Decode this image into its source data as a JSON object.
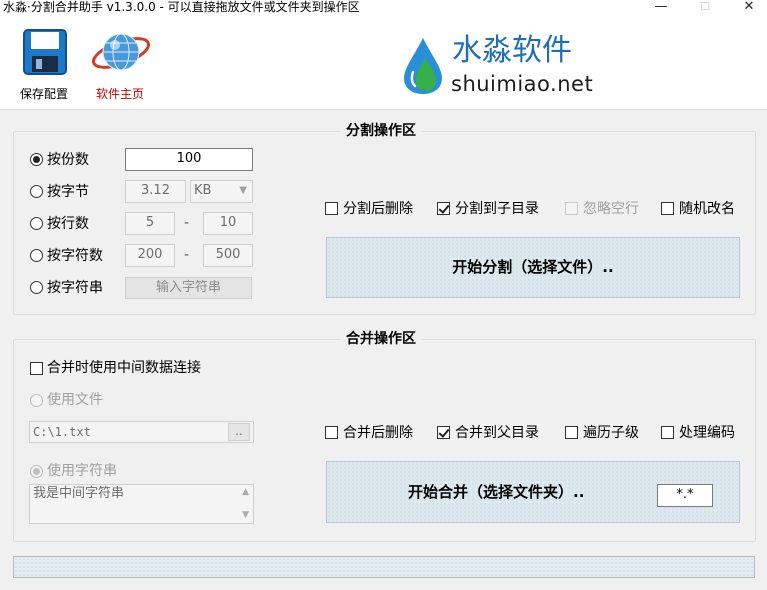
{
  "window": {
    "title": "水淼·分割合并助手 v1.3.0.0 - 可以直接拖放文件或文件夹到操作区",
    "minimize_glyph": "—",
    "maximize_glyph": "☐",
    "close_glyph": "✕"
  },
  "toolbar": {
    "save_label": "保存配置",
    "home_label": "软件主页"
  },
  "brand": {
    "name": "水淼软件",
    "domain": "shuimiao.net"
  },
  "split": {
    "title": "分割操作区",
    "by_count_label": "按份数",
    "by_count_value": "100",
    "by_bytes_label": "按字节",
    "by_bytes_value": "3.12",
    "by_bytes_unit": "KB",
    "by_lines_label": "按行数",
    "by_lines_min": "5",
    "by_lines_max": "10",
    "by_chars_label": "按字符数",
    "by_chars_min": "200",
    "by_chars_max": "500",
    "by_string_label": "按字符串",
    "by_string_placeholder": "输入字符串",
    "range_sep": "-",
    "opt_delete_after": "分割后删除",
    "opt_to_subdir": "分割到子目录",
    "opt_ignore_empty": "忽略空行",
    "opt_random_name": "随机改名",
    "start_button": "开始分割（选择文件）.."
  },
  "merge": {
    "title": "合并操作区",
    "use_middle_label": "合并时使用中间数据连接",
    "use_file_label": "使用文件",
    "file_path": "C:\\1.txt",
    "browse_label": "..",
    "use_string_label": "使用字符串",
    "middle_string": "我是中间字符串",
    "opt_delete_after": "合并后删除",
    "opt_to_parent": "合并到父目录",
    "opt_recursive": "遍历子级",
    "opt_encoding": "处理编码",
    "start_button": "开始合并（选择文件夹）..",
    "filter": "*.*"
  },
  "colors": {
    "home_label": "#d40000",
    "brand_blue": "#1f6fb5",
    "drop_blue": "#2a8fd6",
    "drop_green": "#35b04a"
  }
}
